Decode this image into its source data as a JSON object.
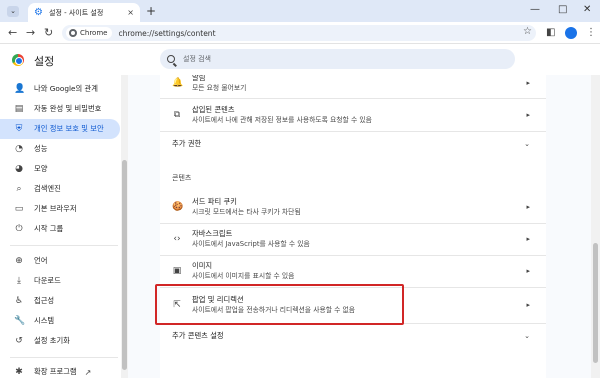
{
  "browser": {
    "tab_title": "설정 - 사이트 설정",
    "tab_close": "×",
    "new_tab": "+",
    "site_chip": "Chrome",
    "url": "chrome://settings/content",
    "window_controls": {
      "minimize": "—",
      "maximize": "□",
      "close": "✕"
    }
  },
  "header": {
    "title": "설정",
    "search_placeholder": "설정 검색"
  },
  "sidebar": {
    "items": [
      {
        "label": "나와 Google의 관계",
        "icon": "person-icon"
      },
      {
        "label": "자동 완성 및 비밀번호",
        "icon": "clipboard-icon"
      },
      {
        "label": "개인 정보 보호 및 보안",
        "icon": "shield-icon",
        "active": true
      },
      {
        "label": "성능",
        "icon": "speedometer-icon"
      },
      {
        "label": "모양",
        "icon": "palette-icon"
      },
      {
        "label": "검색엔진",
        "icon": "search-icon"
      },
      {
        "label": "기본 브라우저",
        "icon": "browser-icon"
      },
      {
        "label": "시작 그룹",
        "icon": "power-icon"
      },
      {
        "label": "언어",
        "icon": "globe-icon"
      },
      {
        "label": "다운로드",
        "icon": "download-icon"
      },
      {
        "label": "접근성",
        "icon": "accessibility-icon"
      },
      {
        "label": "시스템",
        "icon": "wrench-icon"
      },
      {
        "label": "설정 초기화",
        "icon": "reset-icon"
      },
      {
        "label": "확장 프로그램",
        "icon": "extension-icon"
      }
    ]
  },
  "main": {
    "top_rows": [
      {
        "title": "알림",
        "subtitle": "모든 요청 물어보기",
        "icon": "bell-icon"
      },
      {
        "title": "삽입된 콘텐츠",
        "subtitle": "사이트에서 나에 관해 저장된 정보를 사용하도록 요청할 수 있음",
        "icon": "embedded-icon"
      }
    ],
    "more_permissions": "추가 권한",
    "content_section": "콘텐츠",
    "content_rows": [
      {
        "title": "서드 파티 쿠키",
        "subtitle": "시크릿 모드에서는 타사 쿠키가 차단됨",
        "icon": "cookie-icon"
      },
      {
        "title": "자바스크립트",
        "subtitle": "사이트에서 JavaScript를 사용할 수 있음",
        "icon": "code-icon"
      },
      {
        "title": "이미지",
        "subtitle": "사이트에서 이미지를 표시할 수 있음",
        "icon": "image-icon"
      },
      {
        "title": "팝업 및 리디렉션",
        "subtitle": "사이트에서 팝업을 전송하거나 리디렉션을 사용할 수 없음",
        "icon": "popup-icon"
      }
    ],
    "more_content": "추가 콘텐츠 설정"
  },
  "colors": {
    "accent": "#0b57d0",
    "active_bg": "#d3e3fd",
    "highlight_border": "#d12626"
  }
}
